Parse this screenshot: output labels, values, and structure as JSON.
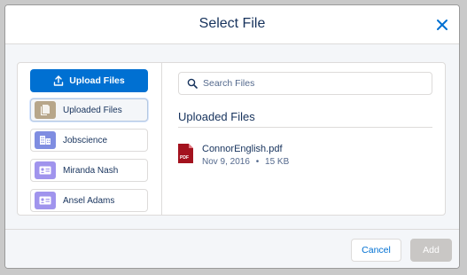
{
  "modal": {
    "title": "Select File"
  },
  "sidebar": {
    "upload_label": "Upload Files",
    "items": [
      {
        "label": "Uploaded Files",
        "icon": "document-icon",
        "color": "#b7a68a",
        "selected": true
      },
      {
        "label": "Jobscience",
        "icon": "building-icon",
        "color": "#7f8de1",
        "selected": false
      },
      {
        "label": "Miranda Nash",
        "icon": "contact-card-icon",
        "color": "#a094ed",
        "selected": false
      },
      {
        "label": "Ansel Adams",
        "icon": "contact-card-icon",
        "color": "#a094ed",
        "selected": false
      }
    ]
  },
  "search": {
    "placeholder": "Search Files",
    "value": ""
  },
  "main": {
    "section_title": "Uploaded Files",
    "files": [
      {
        "name": "ConnorEnglish.pdf",
        "date": "Nov 9, 2016",
        "separator": "•",
        "size": "15 KB",
        "icon": "pdf-icon"
      }
    ]
  },
  "footer": {
    "cancel_label": "Cancel",
    "add_label": "Add"
  },
  "colors": {
    "brand": "#0070d2",
    "title_text": "#16325c",
    "disabled": "#c9c7c5",
    "pdf": "#a3121e"
  }
}
